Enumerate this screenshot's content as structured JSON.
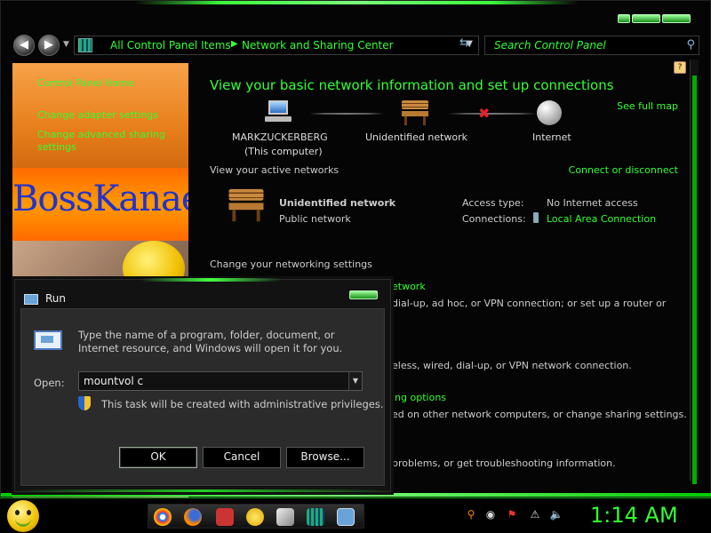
{
  "window": {
    "address": {
      "crumb1": "All Control Panel Items",
      "crumb2": "Network and Sharing Center"
    },
    "search_placeholder": "Search Control Panel"
  },
  "sidebar": {
    "items": [
      {
        "label": "Control Panel Home"
      },
      {
        "label": "Change adapter settings"
      },
      {
        "label": "Change advanced sharing settings"
      }
    ],
    "banner": "BossKanae"
  },
  "main": {
    "heading": "View your basic network information and set up connections",
    "see_full_map": "See full map",
    "nodes": {
      "computer_name": "MARKZUCKERBERG",
      "computer_sub": "(This computer)",
      "network": "Unidentified network",
      "internet": "Internet"
    },
    "active_networks_label": "View your active networks",
    "connect_disconnect": "Connect or disconnect",
    "network_name": "Unidentified network",
    "network_type": "Public network",
    "access_type_label": "Access type:",
    "access_type_value": "No Internet access",
    "connections_label": "Connections:",
    "connections_value": "Local Area Connection",
    "change_settings": "Change your networking settings",
    "partial_lines": [
      "etwork",
      "dial-up, ad hoc, or VPN connection; or set up a router or",
      "eless, wired, dial-up, or VPN network connection.",
      "ing options",
      "ed on other network computers, or change sharing settings.",
      "problems, or get troubleshooting information."
    ]
  },
  "run_dialog": {
    "title": "Run",
    "description": "Type the name of a program, folder, document, or Internet resource, and Windows will open it for you.",
    "open_label": "Open:",
    "open_value": "mountvol c",
    "admin_note": "This task will be created with administrative privileges.",
    "ok": "OK",
    "cancel": "Cancel",
    "browse": "Browse..."
  },
  "taskbar": {
    "clock": "1:14 AM"
  },
  "colors": {
    "accent": "#33ff33",
    "orange_panel": "#e8801c",
    "banner_text": "#2233cc"
  }
}
